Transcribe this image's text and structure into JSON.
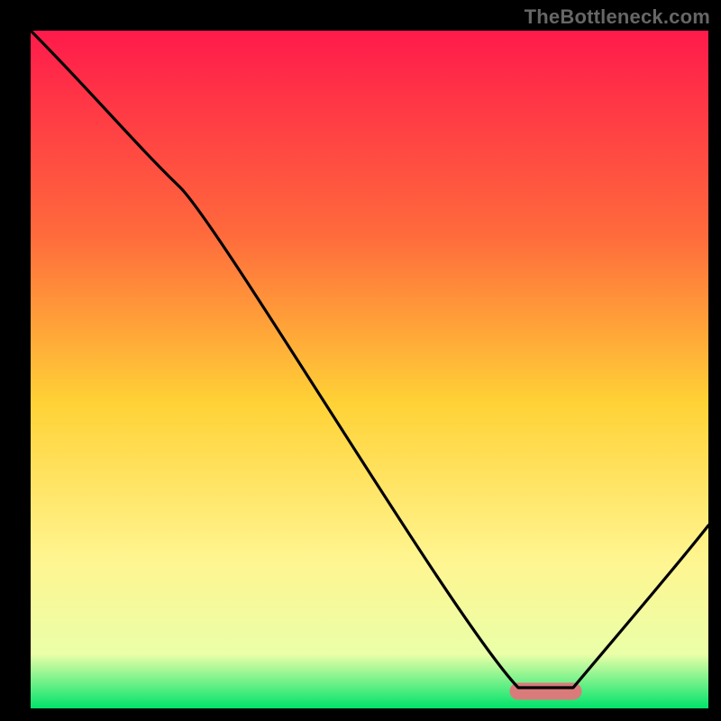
{
  "watermark": "TheBottleneck.com",
  "chart_data": {
    "type": "line",
    "title": "",
    "xlabel": "",
    "ylabel": "",
    "xlim": [
      0,
      100
    ],
    "ylim": [
      0,
      100
    ],
    "grid": false,
    "legend": false,
    "background_gradient": {
      "stops": [
        {
          "offset": 0.0,
          "color": "#ff1a4b"
        },
        {
          "offset": 0.3,
          "color": "#ff6a3c"
        },
        {
          "offset": 0.55,
          "color": "#ffd236"
        },
        {
          "offset": 0.78,
          "color": "#fff590"
        },
        {
          "offset": 0.92,
          "color": "#eaffa8"
        },
        {
          "offset": 1.0,
          "color": "#00e36b"
        }
      ]
    },
    "series": [
      {
        "name": "bottleneck-curve",
        "color": "#000000",
        "x": [
          0,
          22,
          72,
          80,
          100
        ],
        "y": [
          100,
          77,
          3,
          3,
          27
        ]
      }
    ],
    "marker": {
      "name": "optimal-range",
      "color": "#d97b7b",
      "x_start": 72,
      "x_end": 80,
      "y": 2.5,
      "thickness": 2.5
    }
  }
}
